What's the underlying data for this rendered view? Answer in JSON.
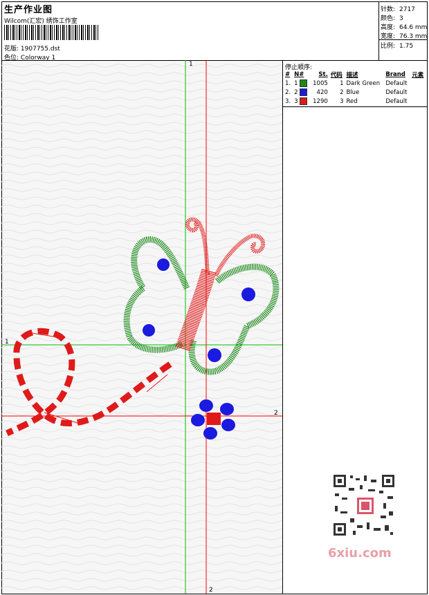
{
  "header": {
    "title": "生产作业图",
    "company": "Wilcom(汇宏) 绣饰工作室",
    "design_label": "花版:",
    "design_file": "1907755.dst",
    "colorway_label": "色位:",
    "colorway": "Colorway 1"
  },
  "stats": [
    {
      "key": "针数:",
      "value": "2717"
    },
    {
      "key": "颜色:",
      "value": "3"
    },
    {
      "key": "高度:",
      "value": "64.6 mm"
    },
    {
      "key": "宽度:",
      "value": "76.3 mm"
    },
    {
      "key": "比例:",
      "value": "1.75"
    }
  ],
  "stop_sequence": {
    "title": "停止顺序:",
    "headers": [
      "#",
      "N#",
      "St.",
      "代码",
      "描述",
      "Brand",
      "元素"
    ],
    "rows": [
      {
        "idx": "1.",
        "n": "1",
        "st": "1005",
        "code": "1",
        "desc": "Dark Green",
        "brand": "Default",
        "color": "#1a8a1a"
      },
      {
        "idx": "2.",
        "n": "2",
        "st": "420",
        "code": "2",
        "desc": "Blue",
        "brand": "Default",
        "color": "#1a1ae0"
      },
      {
        "idx": "3.",
        "n": "3",
        "st": "1290",
        "code": "3",
        "desc": "Red",
        "brand": "Default",
        "color": "#e01a1a"
      }
    ]
  },
  "axes": {
    "v1": "1",
    "v2": "2",
    "h1": "1",
    "h2": "2"
  },
  "watermark": "6xiu.com",
  "colors": {
    "green": "#1a8a1a",
    "blue": "#1a1ae0",
    "red": "#e01a1a",
    "guide_green": "#00c000",
    "guide_red": "#ff0000"
  }
}
